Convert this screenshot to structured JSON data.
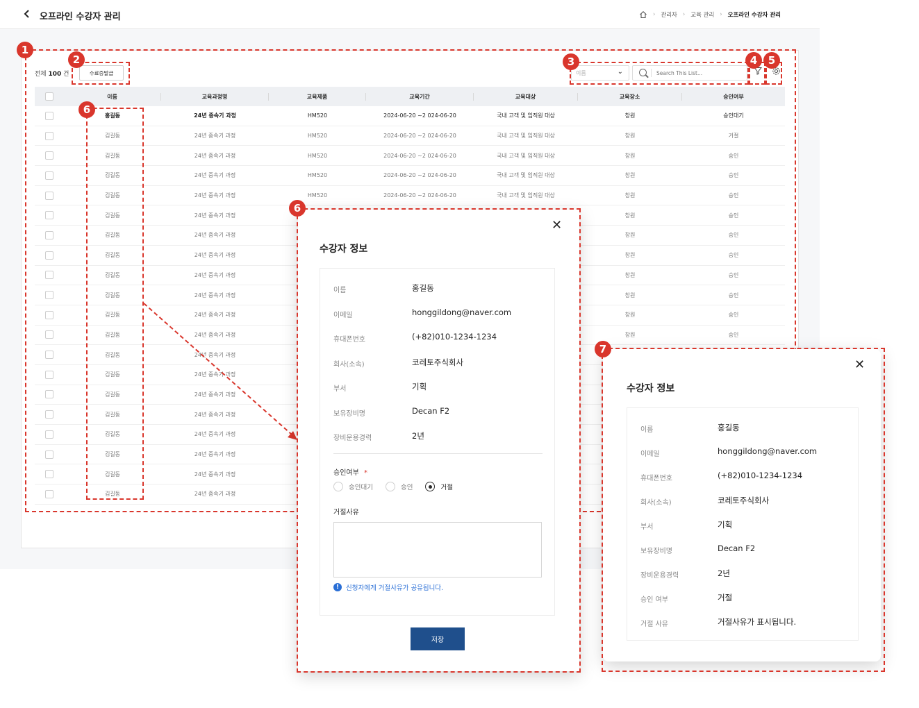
{
  "header": {
    "back_icon": "chevron-left-icon",
    "title": "오프라인 수강자 관리",
    "breadcrumb": [
      "관리자",
      "교육 관리",
      "오프라인 수강자 관리"
    ]
  },
  "toolbar": {
    "total_prefix": "전체",
    "total_count": "100",
    "total_suffix": "건",
    "cert_button": "수료증발급",
    "select_placeholder": "이름",
    "search_placeholder": "Search This List..."
  },
  "table": {
    "columns": [
      "이름",
      "교육과정명",
      "교육제품",
      "교육기간",
      "교육대상",
      "교육장소",
      "승인여부"
    ],
    "rows": [
      [
        "홍길동",
        "24년 중속기 과정",
        "HM520",
        "2024-06-20 ~2 024-06-20",
        "국내 고객 및 임직원 대상",
        "창원",
        "승인대기"
      ],
      [
        "김길동",
        "24년 중속기 과정",
        "HM520",
        "2024-06-20 ~2 024-06-20",
        "국내 고객 및 임직원 대상",
        "창원",
        "거절"
      ],
      [
        "김길동",
        "24년 중속기 과정",
        "HM520",
        "2024-06-20 ~2 024-06-20",
        "국내 고객 및 임직원 대상",
        "창원",
        "승인"
      ],
      [
        "김길동",
        "24년 중속기 과정",
        "HM520",
        "2024-06-20 ~2 024-06-20",
        "국내 고객 및 임직원 대상",
        "창원",
        "승인"
      ],
      [
        "김길동",
        "24년 중속기 과정",
        "HM520",
        "2024-06-20 ~2 024-06-20",
        "국내 고객 및 임직원 대상",
        "창원",
        "승인"
      ],
      [
        "김길동",
        "24년 중속기 과정",
        "",
        "",
        "",
        "창원",
        "승인"
      ],
      [
        "김길동",
        "24년 중속기 과정",
        "",
        "",
        "",
        "창원",
        "승인"
      ],
      [
        "김길동",
        "24년 중속기 과정",
        "",
        "",
        "",
        "창원",
        "승인"
      ],
      [
        "김길동",
        "24년 중속기 과정",
        "",
        "",
        "",
        "창원",
        "승인"
      ],
      [
        "김길동",
        "24년 중속기 과정",
        "",
        "",
        "",
        "창원",
        "승인"
      ],
      [
        "김길동",
        "24년 중속기 과정",
        "",
        "",
        "",
        "창원",
        "승인"
      ],
      [
        "김길동",
        "24년 중속기 과정",
        "",
        "",
        "",
        "창원",
        "승인"
      ],
      [
        "김길동",
        "24년 중속기 과정",
        "",
        "",
        "",
        "",
        ""
      ],
      [
        "김길동",
        "24년 중속기 과정",
        "",
        "",
        "",
        "",
        ""
      ],
      [
        "김길동",
        "24년 중속기 과정",
        "",
        "",
        "",
        "",
        ""
      ],
      [
        "김길동",
        "24년 중속기 과정",
        "",
        "",
        "",
        "",
        ""
      ],
      [
        "김길동",
        "24년 중속기 과정",
        "",
        "",
        "",
        "",
        ""
      ],
      [
        "김길동",
        "24년 중속기 과정",
        "",
        "",
        "",
        "",
        ""
      ],
      [
        "김길동",
        "24년 중속기 과정",
        "",
        "",
        "",
        "",
        ""
      ],
      [
        "김길동",
        "24년 중속기 과정",
        "",
        "",
        "",
        "",
        ""
      ]
    ]
  },
  "annotations": [
    "1",
    "2",
    "3",
    "4",
    "5",
    "6",
    "6",
    "7"
  ],
  "modal_edit": {
    "title": "수강자 정보",
    "fields": [
      {
        "label": "이름",
        "value": "홍길동"
      },
      {
        "label": "이메일",
        "value": "honggildong@naver.com"
      },
      {
        "label": "휴대폰번호",
        "value": "(+82)010-1234-1234"
      },
      {
        "label": "회사(소속)",
        "value": "코레토주식회사"
      },
      {
        "label": "부서",
        "value": "기획"
      },
      {
        "label": "보유장비명",
        "value": "Decan F2"
      },
      {
        "label": "장비운용경력",
        "value": "2년"
      }
    ],
    "approval_label": "승인여부",
    "required_mark": "*",
    "options": [
      "승인대기",
      "승인",
      "거절"
    ],
    "selected_option": "거절",
    "reject_reason_label": "거절사유",
    "notice": "신청자에게 거절사유가 공유됩니다.",
    "save_button": "저장"
  },
  "modal_view": {
    "title": "수강자 정보",
    "fields": [
      {
        "label": "이름",
        "value": "홍길동"
      },
      {
        "label": "이메일",
        "value": "honggildong@naver.com"
      },
      {
        "label": "휴대폰번호",
        "value": "(+82)010-1234-1234"
      },
      {
        "label": "회사(소속)",
        "value": "코레토주식회사"
      },
      {
        "label": "부서",
        "value": "기획"
      },
      {
        "label": "보유장비명",
        "value": "Decan F2"
      },
      {
        "label": "장비운용경력",
        "value": "2년"
      },
      {
        "label": "승인 여부",
        "value": "거절"
      },
      {
        "label": "거절 사유",
        "value": "거절사유가 표시됩니다."
      }
    ]
  },
  "colors": {
    "annotation": "#d9362c",
    "primary": "#1f4f8c",
    "notice": "#2a6fd6"
  }
}
